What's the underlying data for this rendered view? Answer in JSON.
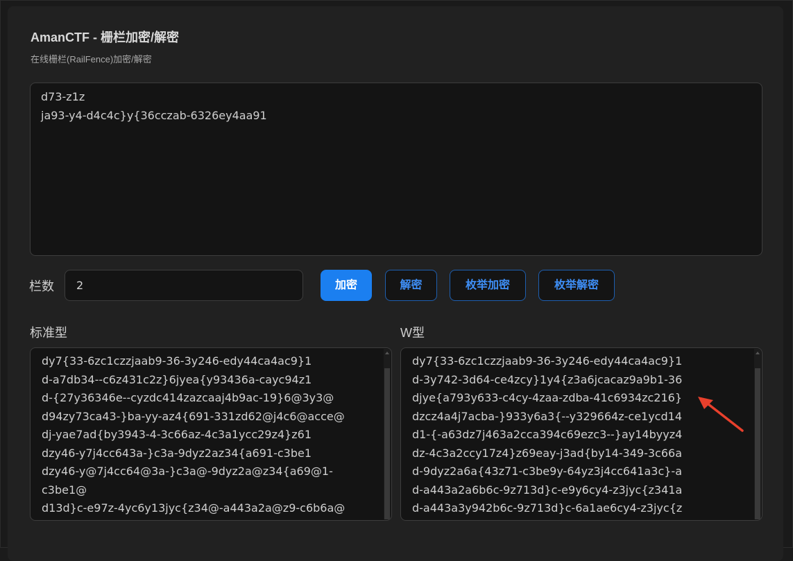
{
  "app": {
    "title": "AmanCTF - 栅栏加密/解密",
    "subtitle": "在线栅栏(RailFence)加密/解密"
  },
  "input": {
    "text": "d73-z1z\nja93-y4-d4c4c}y{36cczab-6326ey4aa91"
  },
  "controls": {
    "rails_label": "栏数",
    "rails_value": "2",
    "encrypt_label": "加密",
    "decrypt_label": "解密",
    "enum_encrypt_label": "枚举加密",
    "enum_decrypt_label": "枚举解密"
  },
  "output_standard": {
    "label": "标准型",
    "lines": [
      "dy7{33-6zc1czzjaab9-36-3y246-edy44ca4ac9}1",
      "d-a7db34--c6z431c2z}6jyea{y93436a-cayc94z1",
      "d-{27y36346e--cyzdc414zazcaaj4b9ac-19}6@3y3@",
      "d94zy73ca43-}ba-yy-az4{691-331zd62@j4c6@acce@",
      "dj-yae7ad{by3943-4-3c66az-4c3a1ycc29z4}z61",
      "dzy46-y7j4cc643a-}c3a-9dyz2az34{a691-c3be1",
      "dzy46-y@7j4cc64@3a-}c3a@-9dyz2a@z34{a69@1-",
      "c3be1@",
      "d13d}c-e97z-4yc6y13jyc{z34@-a443a2a@z9-c6b6a@"
    ]
  },
  "output_w": {
    "label": "W型",
    "lines": [
      "dy7{33-6zc1czzjaab9-36-3y246-edy44ca4ac9}1",
      "d-3y742-3d64-ce4zcy}1y4{z3a6jcacaz9a9b1-36",
      "djye{a793y633-c4cy-4zaa-zdba-41c6934zc216}",
      "dzcz4a4j7acba-}933y6a3{--y329664z-ce1ycd14",
      "d1-{-a63dz7j463a2cca394c69ezc3--}ay14byyz4",
      "dz-4c3a2ccy17z4}z69eay-j3ad{by14-349-3c66a",
      "d-9dyz2a6a{43z71-c3be9y-64yz3j4cc641a3c}-a",
      "d-a443a2a6b6c-9z713d}c-e9y6cy4-z3jyc{z341a",
      "d-a443a3y942b6c-9z713d}c-6a1ae6cy4-z3jyc{z"
    ]
  },
  "colors": {
    "primary": "#1b7ff0",
    "outline_text": "#3e8ef5",
    "annotation_arrow": "#e8402c"
  }
}
